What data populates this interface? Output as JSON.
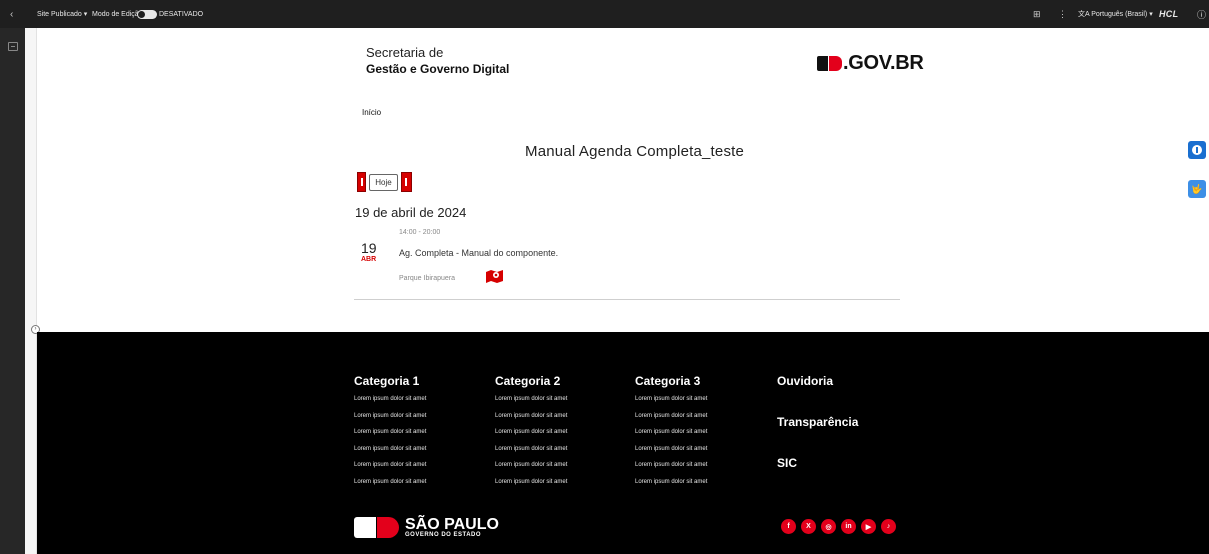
{
  "topbar": {
    "back_icon": "chevron-left-icon",
    "site_selector": "Site Publicado ▾",
    "edit_mode_label": "Modo de Edição",
    "edit_mode_state": "DESATIVADO",
    "language": "文A Português (Brasil) ▾",
    "brand": "HCL",
    "grid_icon": "⊞",
    "dots_icon": "⋮",
    "info_icon": "ⓘ"
  },
  "header": {
    "secretaria_line1": "Secretaria de",
    "secretaria_line2": "Gestão e Governo Digital",
    "gov_logo_text": ".GOV.BR"
  },
  "breadcrumb": {
    "home": "Início"
  },
  "agenda": {
    "title": "Manual Agenda Completa_teste",
    "today_button": "Hoje",
    "date_heading": "19 de abril de 2024",
    "event": {
      "time": "14:00 - 20:00",
      "day": "19",
      "month": "ABR",
      "title": "Ag. Completa - Manual do componente.",
      "location": "Parque Ibirapuera"
    }
  },
  "accessibility": {
    "libras_label": "🤟"
  },
  "footer": {
    "categories": [
      {
        "title": "Categoria 1",
        "links": [
          "Lorem ipsum dolor sit amet",
          "Lorem ipsum dolor sit amet",
          "Lorem ipsum dolor sit amet",
          "Lorem ipsum dolor sit amet",
          "Lorem ipsum dolor sit amet",
          "Lorem ipsum dolor sit amet"
        ]
      },
      {
        "title": "Categoria 2",
        "links": [
          "Lorem ipsum dolor sit amet",
          "Lorem ipsum dolor sit amet",
          "Lorem ipsum dolor sit amet",
          "Lorem ipsum dolor sit amet",
          "Lorem ipsum dolor sit amet",
          "Lorem ipsum dolor sit amet"
        ]
      },
      {
        "title": "Categoria 3",
        "links": [
          "Lorem ipsum dolor sit amet",
          "Lorem ipsum dolor sit amet",
          "Lorem ipsum dolor sit amet",
          "Lorem ipsum dolor sit amet",
          "Lorem ipsum dolor sit amet",
          "Lorem ipsum dolor sit amet"
        ]
      }
    ],
    "side_links": [
      "Ouvidoria",
      "Transparência",
      "SIC"
    ],
    "logo_title": "SÃO PAULO",
    "logo_subtitle": "GOVERNO DO ESTADO",
    "social": [
      {
        "name": "facebook-icon",
        "glyph": "f"
      },
      {
        "name": "x-icon",
        "glyph": "X"
      },
      {
        "name": "instagram-icon",
        "glyph": "◎"
      },
      {
        "name": "linkedin-icon",
        "glyph": "in"
      },
      {
        "name": "youtube-icon",
        "glyph": "▶"
      },
      {
        "name": "tiktok-icon",
        "glyph": "♪"
      }
    ]
  },
  "colors": {
    "brand_red": "#e3001b",
    "accessibility_blue": "#1a6fd0",
    "footer_bg": "#000000",
    "topbar_bg": "#1f1f1f"
  }
}
